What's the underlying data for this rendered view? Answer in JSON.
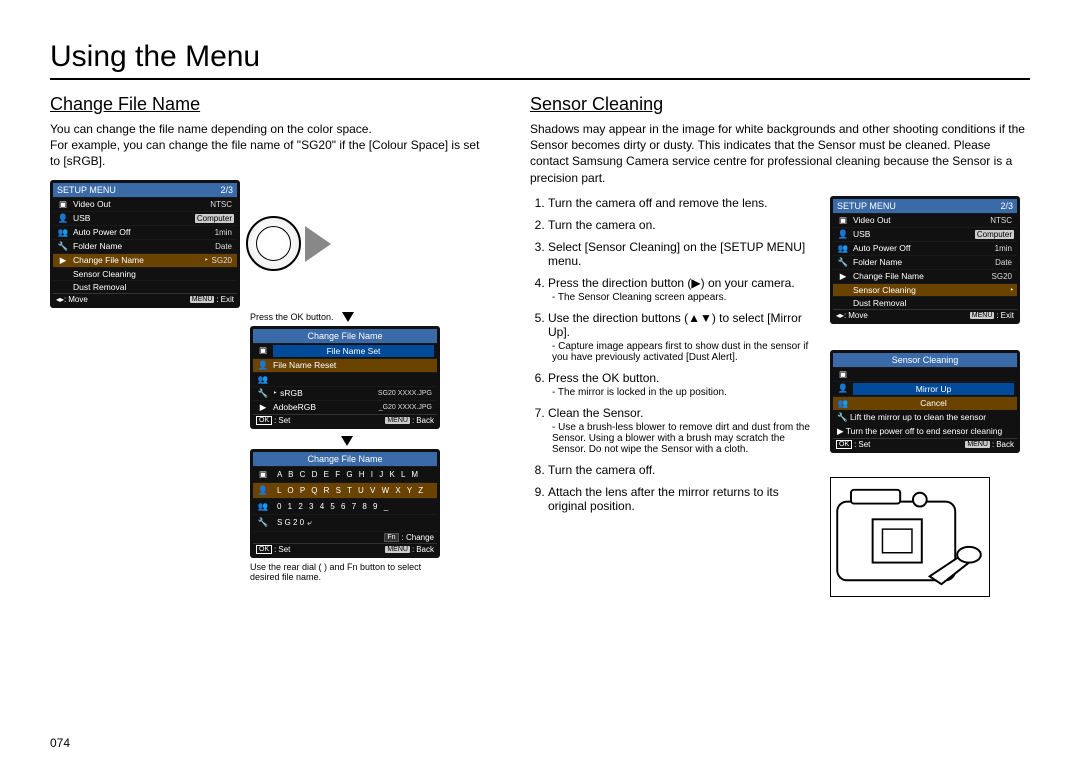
{
  "page_title": "Using the Menu",
  "page_number": "074",
  "left": {
    "title": "Change File Name",
    "intro": "You can change the ﬁle name depending on the color space.\nFor example, you can change the ﬁle name of \"SG20\" if the [Colour Space] is set to [sRGB].",
    "lcd1": {
      "header": "SETUP MENU",
      "page": "2/3",
      "rows": [
        {
          "icon": "📷",
          "label": "Video Out",
          "value": "NTSC"
        },
        {
          "icon": "👤1",
          "label": "USB",
          "value": "Computer",
          "boxed": true
        },
        {
          "icon": "👥2",
          "label": "Auto Power Off",
          "value": "1min"
        },
        {
          "icon": "🔧",
          "label": "Folder Name",
          "value": "Date"
        },
        {
          "icon": "▶",
          "label": "Change File Name",
          "value": "SG20",
          "sel": true,
          "arrow": "‣"
        },
        {
          "icon": "",
          "label": "Sensor Cleaning",
          "value": ""
        },
        {
          "icon": "",
          "label": "Dust Removal",
          "value": ""
        }
      ],
      "footer_left": "Move",
      "footer_right": "Exit"
    },
    "press_ok": "Press the OK button.",
    "lcd2": {
      "header": "Change File Name",
      "rows": [
        {
          "icon": "📷",
          "label": "File Name Set",
          "sel": false,
          "sub": true
        },
        {
          "icon": "👤1",
          "label": "File Name Reset",
          "sel": true
        },
        {
          "icon": "👥2",
          "label": "",
          "sel": false
        },
        {
          "icon": "🔧",
          "label": "sRGB",
          "value": "SG20 XXXX.JPG",
          "arrow": "‣"
        },
        {
          "icon": "▶",
          "label": "AdobeRGB",
          "value": "_G20 XXXX.JPG"
        }
      ],
      "footer_left": "Set",
      "footer_right": "Back"
    },
    "lcd3": {
      "header": "Change File Name",
      "line1": "A B C D E F G H I J K L M",
      "line2": "L O P Q R S T U V W X Y Z",
      "line3": "0 1 2 3 4 5 6 7 8 9 _",
      "current": "S G 2 0",
      "fn_hint": ": Change",
      "footer_left": "Set",
      "footer_right": "Back"
    },
    "caption_dial": "Use the rear dial (        ) and Fn button to select desired ﬁle name."
  },
  "right": {
    "title": "Sensor Cleaning",
    "intro": "Shadows may appear in the image for white backgrounds and other shooting conditions if the Sensor becomes dirty or dusty. This indicates that the Sensor must be cleaned. Please contact Samsung Camera service centre for professional cleaning because the Sensor is a precision part.",
    "steps": [
      {
        "t": "Turn the camera off and remove the lens."
      },
      {
        "t": "Turn the camera on."
      },
      {
        "t": "Select [Sensor Cleaning] on the [SETUP MENU] menu."
      },
      {
        "t": "Press the direction button (▶) on your camera.",
        "sub": "- The Sensor Cleaning screen appears."
      },
      {
        "t": "Use the direction buttons (▲▼) to select [Mirror Up].",
        "sub": "- Capture image appears ﬁrst to show dust in the sensor if you have previously activated [Dust Alert]."
      },
      {
        "t": "Press the OK button.",
        "sub": "- The mirror is locked in the up position."
      },
      {
        "t": "Clean the Sensor.",
        "sub": "- Use a brush-less blower to remove dirt and dust from the Sensor. Using a blower with a brush may scratch the Sensor. Do not wipe the Sensor with a cloth."
      },
      {
        "t": "Turn the camera off."
      },
      {
        "t": "Attach the lens after the mirror returns to its original position."
      }
    ],
    "lcd1": {
      "header": "SETUP MENU",
      "page": "2/3",
      "rows": [
        {
          "icon": "📷",
          "label": "Video Out",
          "value": "NTSC"
        },
        {
          "icon": "👤1",
          "label": "USB",
          "value": "Computer",
          "boxed": true
        },
        {
          "icon": "👥2",
          "label": "Auto Power Off",
          "value": "1min"
        },
        {
          "icon": "🔧",
          "label": "Folder Name",
          "value": "Date"
        },
        {
          "icon": "▶",
          "label": "Change File Name",
          "value": "SG20"
        },
        {
          "icon": "",
          "label": "Sensor Cleaning",
          "sel": true,
          "arrow": "‣"
        },
        {
          "icon": "",
          "label": "Dust Removal"
        }
      ],
      "footer_left": "Move",
      "footer_right": "Exit"
    },
    "lcd2": {
      "header": "Sensor Cleaning",
      "option1": "Mirror Up",
      "option2": "Cancel",
      "hint1": "Lift the mirror up to clean the sensor",
      "hint2": "Turn the power off to end sensor cleaning",
      "footer_left": "Set",
      "footer_right": "Back"
    }
  }
}
